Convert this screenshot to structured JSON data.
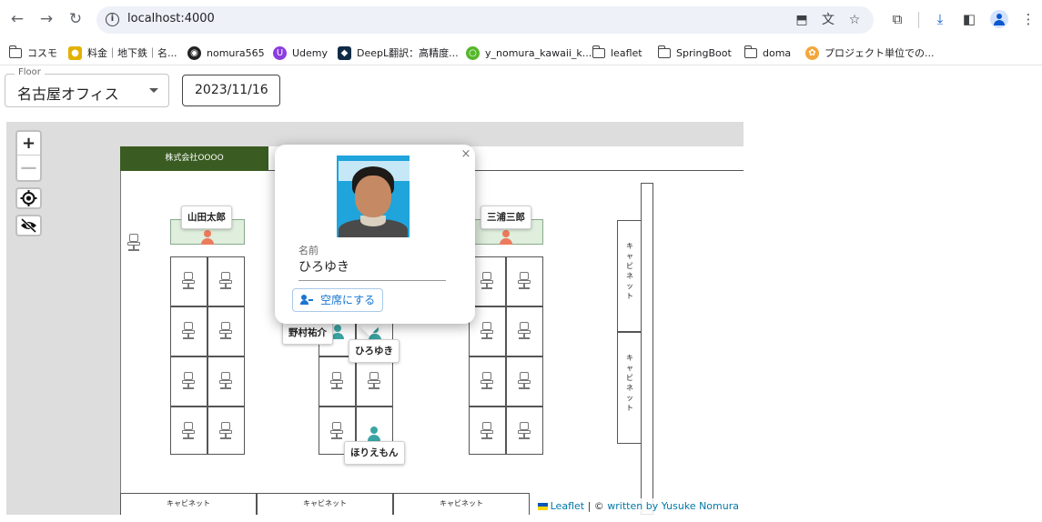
{
  "browser": {
    "url": "localhost:4000",
    "bookmarks": [
      {
        "label": "コスモ",
        "type": "folder"
      },
      {
        "label": "料金｜地下鉄｜名...",
        "type": "site"
      },
      {
        "label": "nomura565",
        "type": "github"
      },
      {
        "label": "Udemy",
        "type": "udemy"
      },
      {
        "label": "DeepL翻訳：高精度...",
        "type": "deepl"
      },
      {
        "label": "y_nomura_kawaii_k...",
        "type": "site"
      },
      {
        "label": "leaflet",
        "type": "folder"
      },
      {
        "label": "SpringBoot",
        "type": "folder"
      },
      {
        "label": "doma",
        "type": "folder"
      },
      {
        "label": "プロジェクト単位での...",
        "type": "site"
      }
    ]
  },
  "controls": {
    "floor_label": "Floor",
    "floor_value": "名古屋オフィス",
    "date": "2023/11/16"
  },
  "map": {
    "company_name": "株式会社OOOO",
    "zoom_in": "+",
    "zoom_out": "—",
    "cabinet_label": "キャビネット",
    "cabinet_vertical": [
      "キ",
      "ャ",
      "ビ",
      "ネ",
      "ッ",
      "ト"
    ],
    "occupants": {
      "left": "山田太郎",
      "right": "三浦三郎",
      "center_left": "野村祐介",
      "center_right": "ひろゆき",
      "bottom": "ほりえもん"
    },
    "attribution": {
      "leaflet": "Leaflet",
      "separator": " | © ",
      "author": "written by Yusuke Nomura"
    },
    "colors": {
      "company_bar": "#3a5c22",
      "person_orange": "#ec7a5c",
      "person_teal": "#3aa5a4",
      "link": "#0078a8"
    }
  },
  "popup": {
    "close": "×",
    "name_label": "名前",
    "name_value": "ひろゆき",
    "vacate_button": "空席にする"
  }
}
